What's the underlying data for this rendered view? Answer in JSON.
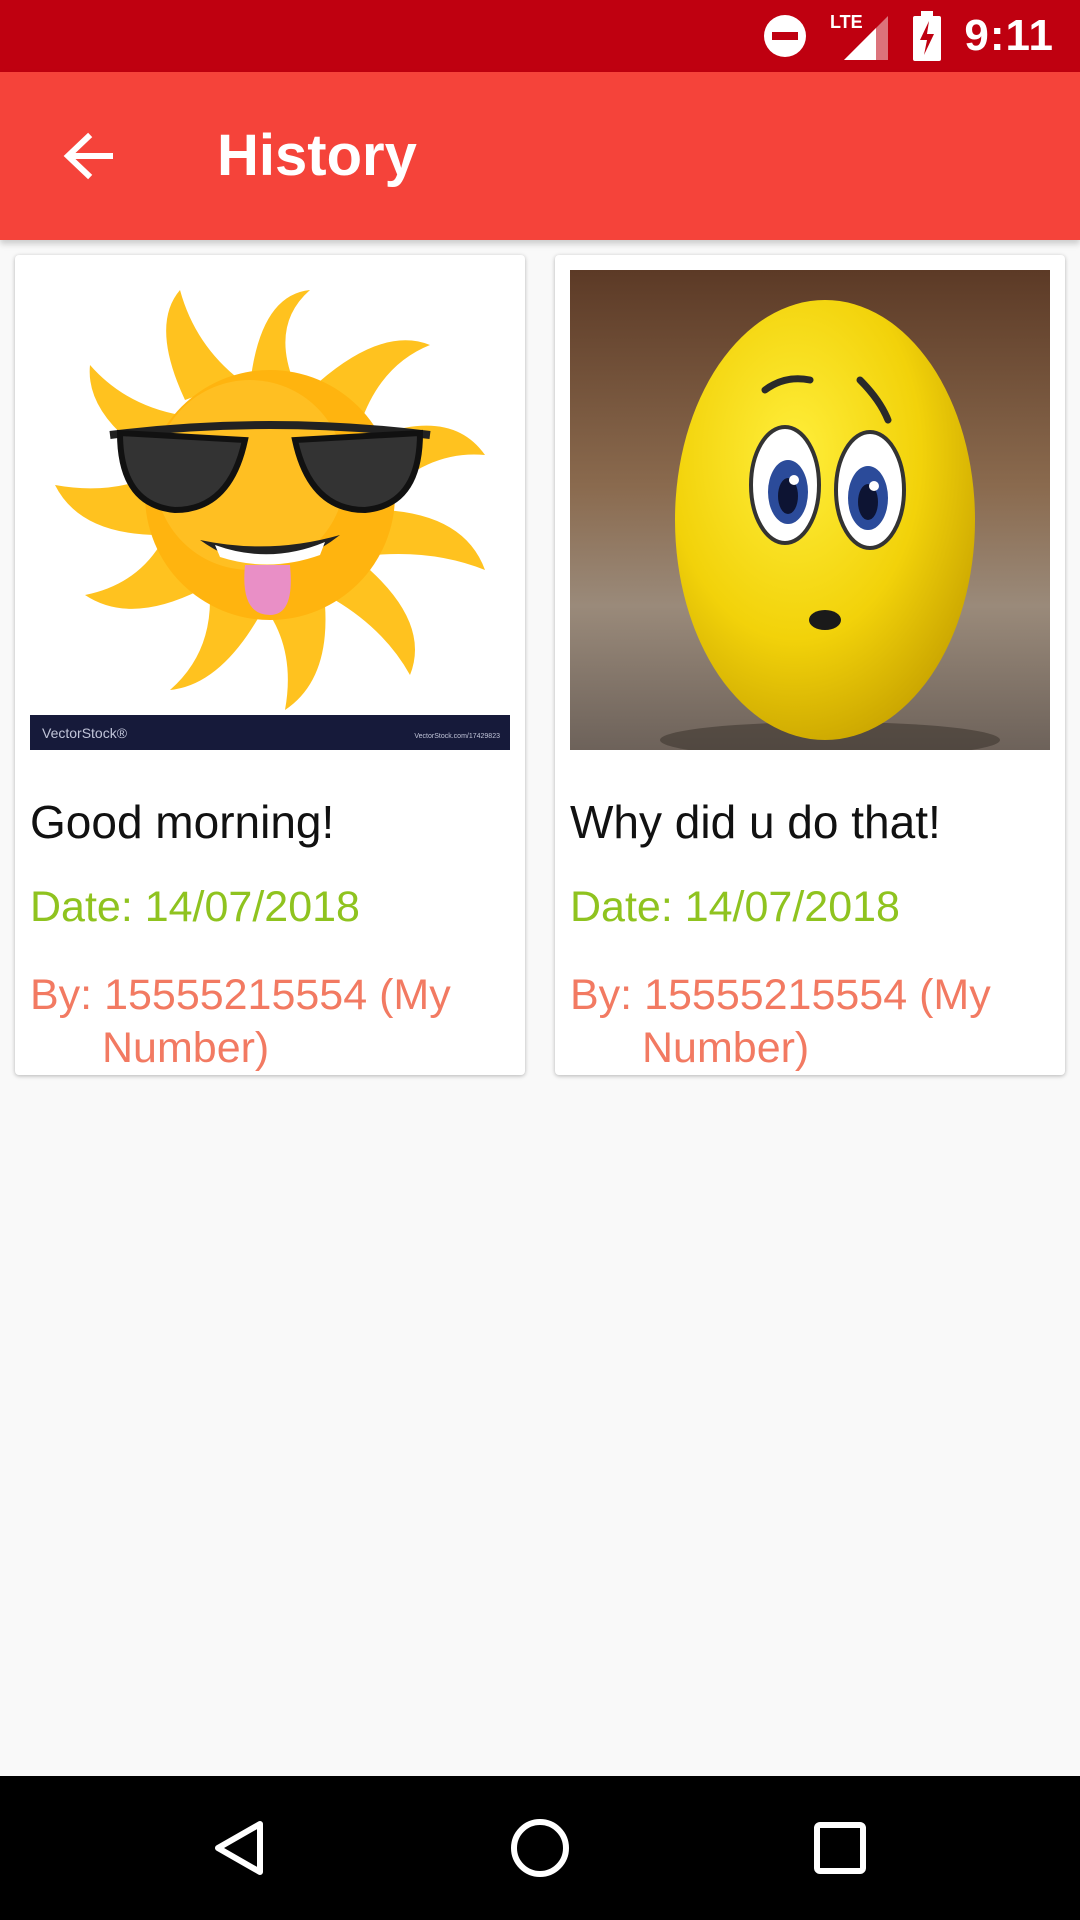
{
  "status_bar": {
    "time": "9:11",
    "network_label": "LTE",
    "icons": [
      "do-not-disturb-icon",
      "signal-icon",
      "battery-charging-icon"
    ]
  },
  "app_bar": {
    "title": "History",
    "back_icon": "arrow-back-icon",
    "color": "#f5433a",
    "status_color": "#bf0010"
  },
  "history": {
    "items": [
      {
        "title": "Good morning!",
        "date": "Date: 14/07/2018",
        "by_line1": "By: 15555215554 (My",
        "by_line2": "Number)",
        "image": "sun-with-sunglasses-image",
        "watermark_left": "VectorStock®",
        "watermark_right": "VectorStock.com/17429823"
      },
      {
        "title": "Why did u do that!",
        "date": "Date: 14/07/2018",
        "by_line1": "By: 15555215554 (My",
        "by_line2": "Number)",
        "image": "worried-yellow-egg-face-image"
      }
    ],
    "date_color": "#8fc31f",
    "by_color": "#f27a62"
  },
  "nav_bar": {
    "icons": [
      "back-triangle-icon",
      "home-circle-icon",
      "recents-square-icon"
    ]
  }
}
